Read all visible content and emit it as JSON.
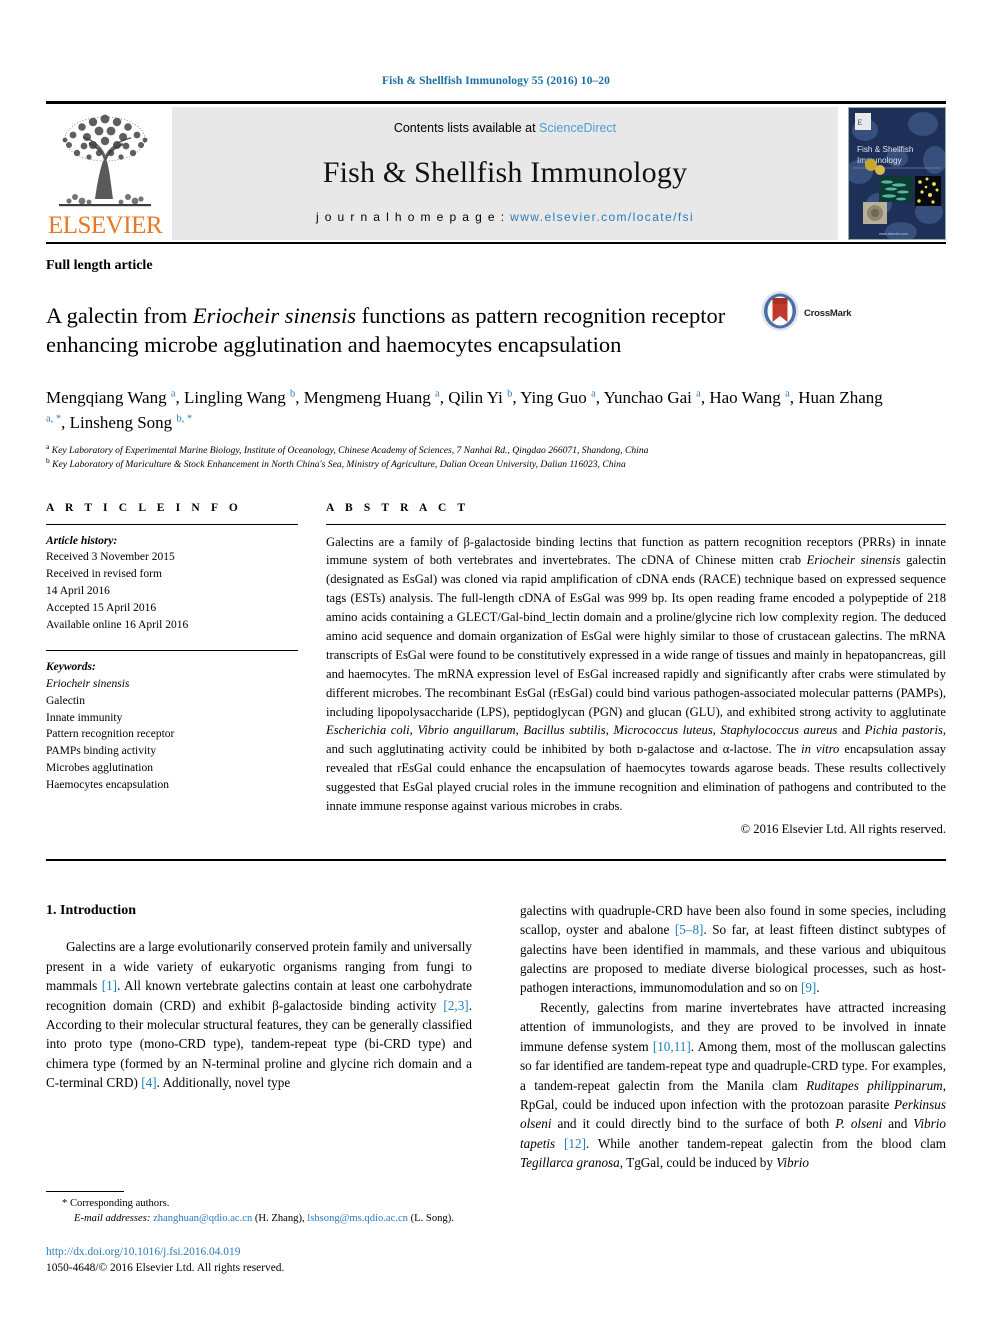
{
  "running_head": "Fish & Shellfish Immunology 55 (2016) 10–20",
  "masthead": {
    "publisher_name": "ELSEVIER",
    "contents_prefix": "Contents lists available at ",
    "contents_link": "ScienceDirect",
    "journal_title": "Fish & Shellfish Immunology",
    "homepage_prefix": "j o u r n a l   h o m e p a g e :  ",
    "homepage_url": "www.elsevier.com/locate/fsi",
    "cover_title_line1": "Fish & Shellfish",
    "cover_title_line2": "Immunology"
  },
  "article_type": "Full length article",
  "title": {
    "part1": "A galectin from ",
    "species": "Eriocheir sinensis",
    "part2": " functions as pattern recognition receptor enhancing microbe agglutination and haemocytes encapsulation"
  },
  "crossmark": {
    "label": "CrossMark"
  },
  "authors": [
    {
      "name": "Mengqiang Wang",
      "sup": "a",
      "sep": ", "
    },
    {
      "name": "Lingling Wang",
      "sup": "b",
      "sep": ", "
    },
    {
      "name": "Mengmeng Huang",
      "sup": "a",
      "sep": ", "
    },
    {
      "name": "Qilin Yi",
      "sup": "b",
      "sep": ", "
    },
    {
      "name": "Ying Guo",
      "sup": "a",
      "sep": ", "
    },
    {
      "name": "Yunchao Gai",
      "sup": "a",
      "sep": ", "
    },
    {
      "name": "Hao Wang",
      "sup": "a",
      "sep": ", "
    },
    {
      "name": "Huan Zhang",
      "sup": "a, *",
      "sep": ", "
    },
    {
      "name": "Linsheng Song",
      "sup": "b, *",
      "sep": ""
    }
  ],
  "affiliations": [
    {
      "marker": "a",
      "text": "Key Laboratory of Experimental Marine Biology, Institute of Oceanology, Chinese Academy of Sciences, 7 Nanhai Rd., Qingdao 266071, Shandong, China"
    },
    {
      "marker": "b",
      "text": "Key Laboratory of Mariculture & Stock Enhancement in North China's Sea, Ministry of Agriculture, Dalian Ocean University, Dalian 116023, China"
    }
  ],
  "article_info": {
    "heading": "A R T I C L E   I N F O",
    "history_label": "Article history:",
    "history": [
      "Received 3 November 2015",
      "Received in revised form",
      "14 April 2016",
      "Accepted 15 April 2016",
      "Available online 16 April 2016"
    ],
    "keywords_label": "Keywords:",
    "keywords": [
      "Eriocheir sinensis",
      "Galectin",
      "Innate immunity",
      "Pattern recognition receptor",
      "PAMPs binding activity",
      "Microbes agglutination",
      "Haemocytes encapsulation"
    ]
  },
  "abstract": {
    "heading": "A B S T R A C T",
    "copyright": "© 2016 Elsevier Ltd. All rights reserved."
  },
  "introduction": {
    "heading": "1. Introduction"
  },
  "footnote": {
    "corresponding_marker": "*",
    "corresponding_text": "Corresponding authors.",
    "email_label": "E-mail addresses:",
    "email1": "zhanghuan@qdio.ac.cn",
    "email1_owner": "(H. Zhang)",
    "email2": "lshsong@ms.qdio.ac.cn",
    "email2_owner": "(L. Song)",
    "doi": "http://dx.doi.org/10.1016/j.fsi.2016.04.019",
    "issn_line": "1050-4648/© 2016 Elsevier Ltd. All rights reserved."
  },
  "colors": {
    "link_blue": "#2b7bb9",
    "reference_blue": "#1a7fc1",
    "elsevier_orange": "#e87722",
    "masthead_gray": "#e8e8e8",
    "running_head_blue": "#1a6fa3",
    "cover_navy": "#1e2f58"
  }
}
